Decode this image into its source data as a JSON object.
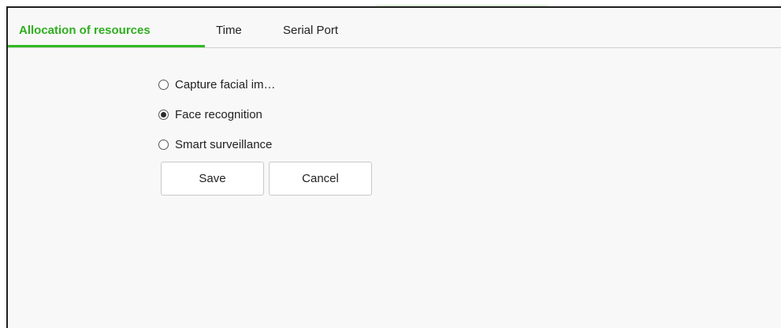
{
  "tabs": [
    {
      "label": "Allocation of resources",
      "active": true
    },
    {
      "label": "Time",
      "active": false
    },
    {
      "label": "Serial Port",
      "active": false
    }
  ],
  "options": [
    {
      "label": "Capture facial im…",
      "selected": false
    },
    {
      "label": "Face recognition",
      "selected": true
    },
    {
      "label": "Smart surveillance",
      "selected": false
    }
  ],
  "actions": {
    "save_label": "Save",
    "cancel_label": "Cancel"
  },
  "colors": {
    "accent": "#32b923",
    "active_tab_text": "#2fae1f",
    "frame_background": "#f8f8f8",
    "frame_border": "#1f1f1f"
  }
}
